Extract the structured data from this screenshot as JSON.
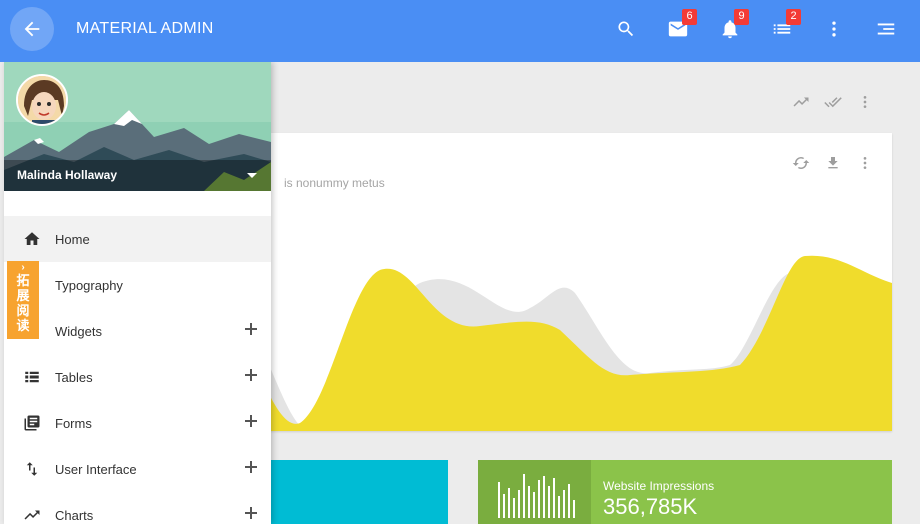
{
  "header": {
    "brand": "MATERIAL ADMIN",
    "icons": {
      "back": "arrow-left-icon",
      "search": "search-icon",
      "mail": "mail-icon",
      "notifications": "bell-icon",
      "tasks": "list-icon",
      "more": "more-vertical-icon",
      "menu": "menu-right-icon"
    },
    "badges": {
      "mail": "6",
      "notifications": "9",
      "tasks": "2"
    }
  },
  "drawer": {
    "user_name": "Malinda Hollaway",
    "menu": [
      {
        "label": "Home",
        "icon": "home-icon",
        "expandable": false,
        "active": true
      },
      {
        "label": "Typography",
        "icon": "typography-icon",
        "expandable": false,
        "active": false
      },
      {
        "label": "Widgets",
        "icon": "widgets-icon",
        "expandable": true,
        "active": false
      },
      {
        "label": "Tables",
        "icon": "table-icon",
        "expandable": true,
        "active": false
      },
      {
        "label": "Forms",
        "icon": "forms-icon",
        "expandable": true,
        "active": false
      },
      {
        "label": "User Interface",
        "icon": "swap-icon",
        "expandable": true,
        "active": false
      },
      {
        "label": "Charts",
        "icon": "trending-icon",
        "expandable": true,
        "active": false
      }
    ]
  },
  "promo_tab": {
    "text": "拓展阅读"
  },
  "main": {
    "card_subtitle": "is nonummy metus",
    "stat_green": {
      "label": "Website Impressions",
      "value": "356,785K"
    }
  },
  "colors": {
    "header": "#4a8ef4",
    "chart_fill": "#f0dc2c",
    "chart_shadow": "#e4e4e4",
    "cyan": "#00bcd4",
    "green": "#8bc34a",
    "promo": "#f7a32f"
  }
}
